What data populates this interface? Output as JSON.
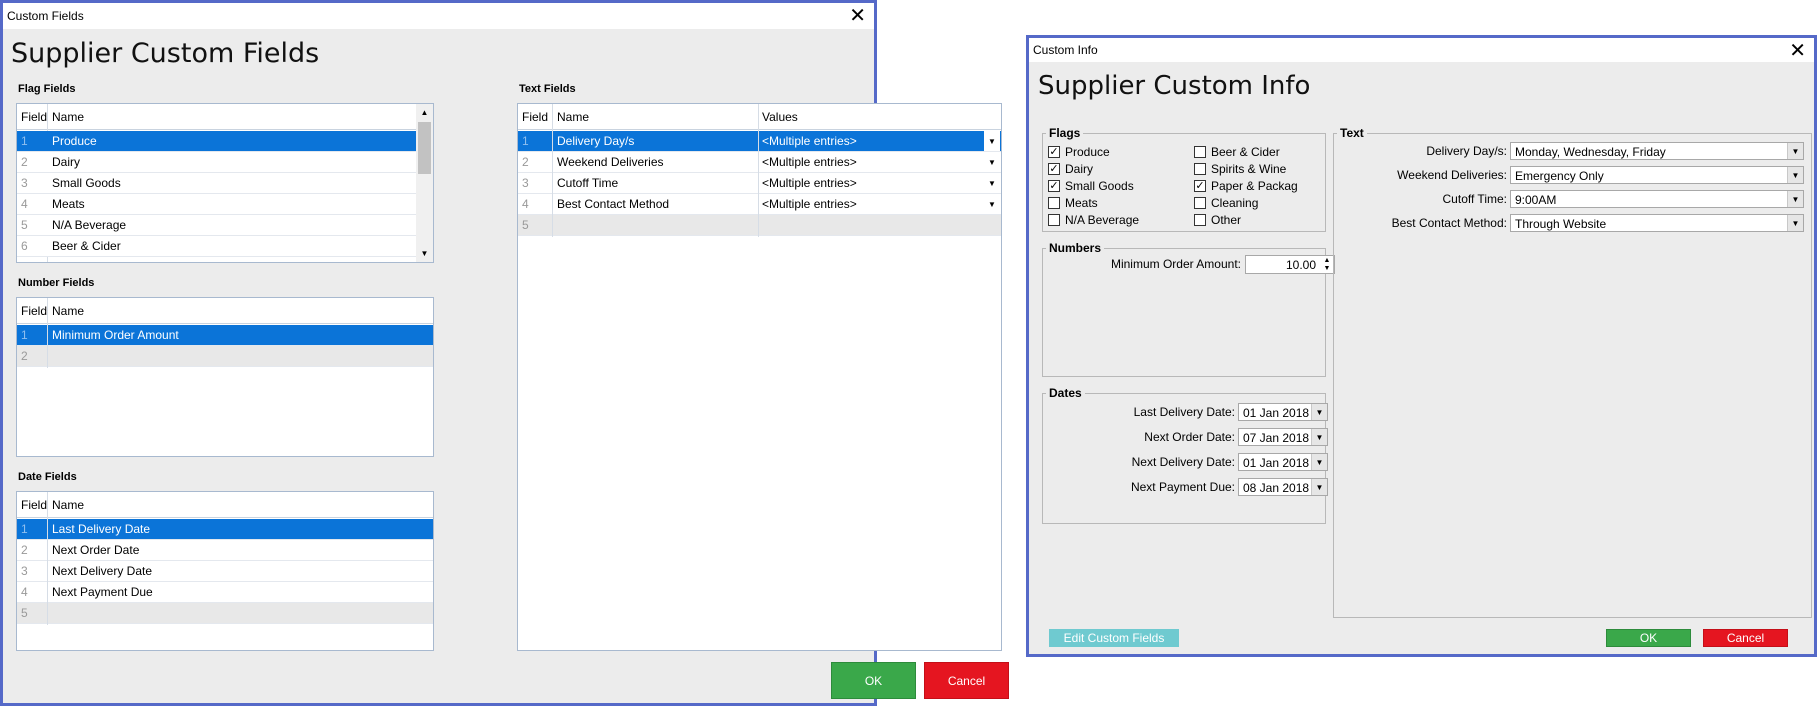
{
  "left": {
    "window_title": "Custom Fields",
    "heading": "Supplier Custom Fields",
    "flag_fields": {
      "label": "Flag Fields",
      "col_field": "Field",
      "col_name": "Name",
      "rows": [
        {
          "field": "1",
          "name": "Produce"
        },
        {
          "field": "2",
          "name": "Dairy"
        },
        {
          "field": "3",
          "name": "Small Goods"
        },
        {
          "field": "4",
          "name": "Meats"
        },
        {
          "field": "5",
          "name": "N/A Beverage"
        },
        {
          "field": "6",
          "name": "Beer & Cider"
        }
      ]
    },
    "number_fields": {
      "label": "Number Fields",
      "col_field": "Field",
      "col_name": "Name",
      "rows": [
        {
          "field": "1",
          "name": "Minimum Order Amount"
        },
        {
          "field": "2",
          "name": ""
        }
      ]
    },
    "date_fields": {
      "label": "Date Fields",
      "col_field": "Field",
      "col_name": "Name",
      "rows": [
        {
          "field": "1",
          "name": "Last Delivery Date"
        },
        {
          "field": "2",
          "name": "Next Order Date"
        },
        {
          "field": "3",
          "name": "Next Delivery Date"
        },
        {
          "field": "4",
          "name": "Next Payment Due"
        },
        {
          "field": "5",
          "name": ""
        }
      ]
    },
    "text_fields": {
      "label": "Text Fields",
      "col_field": "Field",
      "col_name": "Name",
      "col_values": "Values",
      "rows": [
        {
          "field": "1",
          "name": "Delivery Day/s",
          "values": "<Multiple entries>"
        },
        {
          "field": "2",
          "name": "Weekend Deliveries",
          "values": "<Multiple entries>"
        },
        {
          "field": "3",
          "name": "Cutoff Time",
          "values": "<Multiple entries>"
        },
        {
          "field": "4",
          "name": "Best Contact Method",
          "values": "<Multiple entries>"
        },
        {
          "field": "5",
          "name": "",
          "values": ""
        }
      ]
    },
    "ok_label": "OK",
    "cancel_label": "Cancel"
  },
  "right": {
    "window_title": "Custom Info",
    "heading": "Supplier Custom Info",
    "flags": {
      "label": "Flags",
      "items": [
        {
          "label": "Produce",
          "checked": true
        },
        {
          "label": "Dairy",
          "checked": true
        },
        {
          "label": "Small Goods",
          "checked": true
        },
        {
          "label": "Meats",
          "checked": false
        },
        {
          "label": "N/A Beverage",
          "checked": false
        },
        {
          "label": "Beer & Cider",
          "checked": false
        },
        {
          "label": "Spirits & Wine",
          "checked": false
        },
        {
          "label": "Paper & Packag",
          "checked": true
        },
        {
          "label": "Cleaning",
          "checked": false
        },
        {
          "label": "Other",
          "checked": false
        }
      ]
    },
    "numbers": {
      "label": "Numbers",
      "min_order_label": "Minimum Order Amount:",
      "min_order_value": "10.00"
    },
    "dates": {
      "label": "Dates",
      "items": [
        {
          "label": "Last Delivery Date:",
          "value": "01 Jan 2018"
        },
        {
          "label": "Next Order Date:",
          "value": "07 Jan 2018"
        },
        {
          "label": "Next Delivery Date:",
          "value": "01 Jan 2018"
        },
        {
          "label": "Next Payment Due:",
          "value": "08 Jan 2018"
        }
      ]
    },
    "text": {
      "label": "Text",
      "items": [
        {
          "label": "Delivery Day/s:",
          "value": "Monday, Wednesday, Friday"
        },
        {
          "label": "Weekend Deliveries:",
          "value": "Emergency Only"
        },
        {
          "label": "Cutoff Time:",
          "value": "9:00AM"
        },
        {
          "label": "Best Contact Method:",
          "value": "Through Website"
        }
      ]
    },
    "edit_label": "Edit Custom Fields",
    "ok_label": "OK",
    "cancel_label": "Cancel"
  },
  "colors": {
    "selection": "#0b74d8",
    "ok": "#3aa84a",
    "cancel": "#e51520",
    "edit": "#6fcad0",
    "window_border": "#5569c8"
  }
}
